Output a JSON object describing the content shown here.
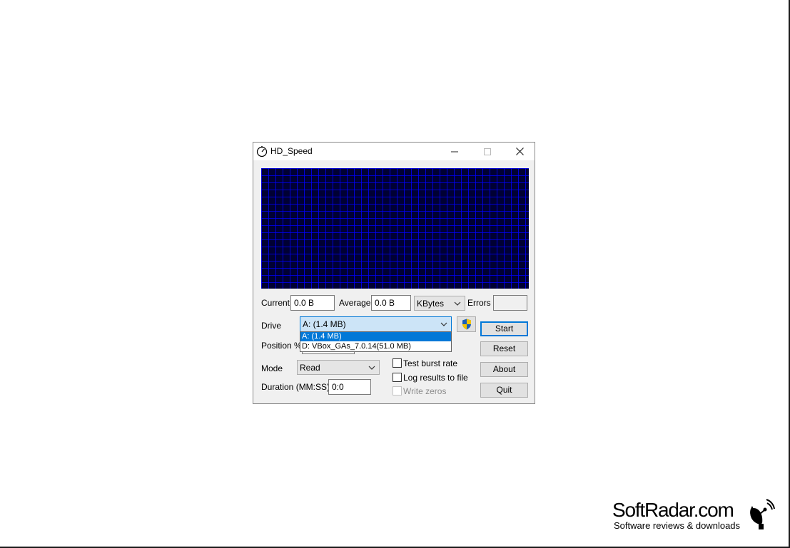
{
  "window": {
    "title": "HD_Speed",
    "icons": {
      "app": "stopwatch-icon",
      "minimize": "minimize-icon",
      "maximize": "maximize-icon",
      "close": "close-icon"
    }
  },
  "graph": {
    "background": "#000033",
    "grid_color": "#0000ff"
  },
  "stats": {
    "current_label": "Current",
    "current_value": "0.0 B",
    "average_label": "Average",
    "average_value": "0.0 B",
    "unit_selected": "KBytes",
    "errors_label": "Errors",
    "errors_value": ""
  },
  "drive": {
    "label": "Drive",
    "selected": "A: (1.4 MB)",
    "options": [
      "A: (1.4 MB)",
      "D: VBox_GAs_7.0.14(51.0 MB)"
    ],
    "shield_icon": "uac-shield-icon"
  },
  "position": {
    "label": "Position %"
  },
  "mode": {
    "label": "Mode",
    "selected": "Read"
  },
  "duration": {
    "label": "Duration (MM:SS)",
    "value": "0:0"
  },
  "options": {
    "test_burst_rate": {
      "label": "Test burst rate",
      "checked": false
    },
    "log_results": {
      "label": "Log results to file",
      "checked": false
    },
    "write_zeros": {
      "label": "Write zeros",
      "checked": false,
      "disabled": true
    }
  },
  "buttons": {
    "start": "Start",
    "reset": "Reset",
    "about": "About",
    "quit": "Quit"
  },
  "watermark": {
    "name": "SoftRadar.com",
    "tagline": "Software reviews & downloads",
    "icon": "satellite-dish-icon"
  },
  "colors": {
    "accent": "#0078d7",
    "window_bg": "#f0f0f0",
    "shield_blue": "#1b5fb8",
    "shield_yellow": "#f5c400"
  }
}
